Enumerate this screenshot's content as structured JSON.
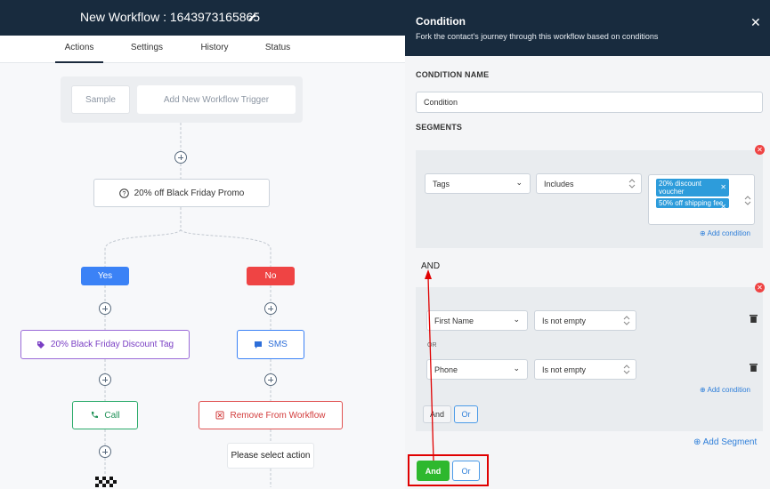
{
  "workflow": {
    "title": "New Workflow : 1643973165865",
    "tabs": [
      "Actions",
      "Settings",
      "History",
      "Status"
    ],
    "trigger": {
      "sample_label": "Sample",
      "add_trigger_label": "Add New Workflow Trigger"
    },
    "condition_node": "20% off Black Friday Promo",
    "yes_label": "Yes",
    "no_label": "No",
    "yes_branch": {
      "tag_action": "20% Black Friday Discount Tag",
      "call_action": "Call"
    },
    "no_branch": {
      "sms_action": "SMS",
      "remove_action": "Remove From Workflow",
      "placeholder": "Please select action"
    }
  },
  "panel": {
    "title": "Condition",
    "subtitle": "Fork the contact's journey through this workflow based on conditions",
    "condition_name_label": "CONDITION NAME",
    "condition_name_value": "Condition",
    "segments_label": "SEGMENTS",
    "segment1": {
      "field": "Tags",
      "operator": "Includes",
      "chips": [
        "20% discount voucher",
        "50% off shipping fee"
      ],
      "add_condition": "Add condition"
    },
    "joiner": "AND",
    "segment2": {
      "cond1_field": "First Name",
      "cond1_operator": "Is not empty",
      "or_label": "OR",
      "cond2_field": "Phone",
      "cond2_operator": "Is not empty",
      "add_condition": "Add condition",
      "and_label": "And",
      "or_button": "Or"
    },
    "add_segment": "Add Segment",
    "footer": {
      "and_label": "And",
      "or_label": "Or"
    }
  },
  "colors": {
    "header": "#182b3e",
    "accent_green": "#2eb82e",
    "accent_blue": "#3b82f6",
    "danger": "#ef4444",
    "highlight": "#e00000"
  }
}
